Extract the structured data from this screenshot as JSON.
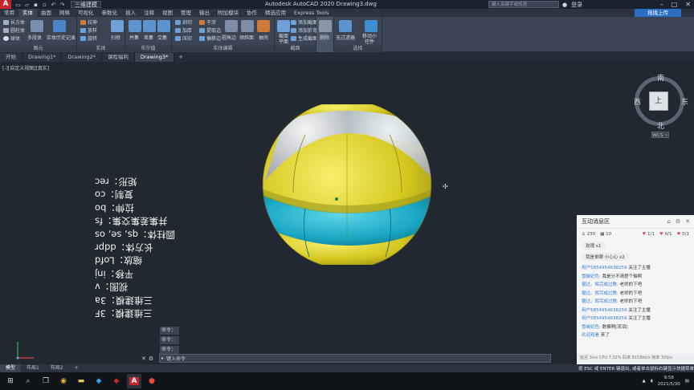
{
  "titlebar": {
    "app_title": "Autodesk AutoCAD 2020    Drawing3.dwg",
    "workspace": "三维建模",
    "search_placeholder": "键入关键字或短语",
    "user": "登录",
    "share_button": "拖拽上传"
  },
  "menu_tabs": [
    "常用",
    "实体",
    "曲面",
    "网格",
    "可视化",
    "参数化",
    "插入",
    "注释",
    "视图",
    "管理",
    "输出",
    "附加模块",
    "协作",
    "精选应用",
    "Express Tools"
  ],
  "active_menu": 1,
  "ribbon": {
    "primitive": {
      "items": [
        "长方体",
        "圆柱体",
        "球体"
      ],
      "big": [
        "多段体",
        "实体历史记录"
      ],
      "title": "图元"
    },
    "solid": {
      "items": [
        "拉伸",
        "放样",
        "旋转",
        "扫掠"
      ],
      "big": [
        "并集",
        "差集",
        "交集"
      ],
      "title": "实体"
    },
    "boolean_title": "布尔值",
    "edit": {
      "items": [
        "剖切",
        "加厚",
        "压印",
        "干涉",
        "提取边",
        "偏移边"
      ],
      "big": [
        "圆角边",
        "倾斜面",
        "抽壳"
      ],
      "title": "实体编辑"
    },
    "section": {
      "items": [
        "添加截面",
        "添加折弯",
        "生成截面"
      ],
      "big": [
        "截面平面"
      ],
      "title": "截面"
    },
    "delete": "删除",
    "selection": {
      "big": [
        "无过滤器",
        "移动小控件"
      ],
      "title": "选择"
    }
  },
  "doc_tabs": [
    "开始",
    "Drawing1*",
    "Drawing2*",
    "课程福利",
    "Drawing3*"
  ],
  "active_doc": 4,
  "viewport": {
    "label": "[-][自定义视图][真实]",
    "compass": {
      "n": "南",
      "s": "北",
      "w": "西",
      "e": "东",
      "face": "上",
      "wcs": "WCS ~"
    }
  },
  "mirrored_text": [
    "三维建模：3F",
    "三维建模：3a",
    "视图：v",
    "平移：inj",
    "缩放：Lofd",
    "长方体：ddpr",
    "圆柱体：qs, se, os",
    "并集差集交集：fs",
    "拉伸：bo",
    "复制：co",
    "矩形：rec"
  ],
  "command": {
    "history": [
      "命令：",
      "命令：",
      "命令："
    ],
    "placeholder": "键入命令"
  },
  "chat": {
    "title": "互动消息区",
    "viewers": "230",
    "likes": "10",
    "counters": [
      "1/1",
      "0/1",
      "0/1"
    ],
    "gifts": [
      "玫瑰 x1",
      "我是单眼 小心心 x2"
    ],
    "messages": [
      {
        "user": "用户5854954638259",
        "text": "关注了主播"
      },
      {
        "user": "雪碳妃色:",
        "text": "我是分不清楚个轴啊"
      },
      {
        "user": "锯过。辉完成过教:",
        "text": "老师的下吧"
      },
      {
        "user": "锯过。辉完成过教:",
        "text": "老师的下吧"
      },
      {
        "user": "锯过。辉完成过教:",
        "text": "老师的下吧"
      },
      {
        "user": "用户5854954638259",
        "text": "关注了主播"
      },
      {
        "user": "用户5854954638259",
        "text": "关注了主播"
      },
      {
        "user": "雪碳妃色:",
        "text": "数模啊[流泪]"
      },
      {
        "user": "欢迎观看",
        "text": "来了"
      }
    ],
    "status": "延迟 3ms  CPU 7.02%  码率 8159kb/s  帧率 30fps"
  },
  "layout_tabs": [
    "模型",
    "布局1",
    "布局2"
  ],
  "hint": "按 ESC 或 ENTER 键退出, 或者单击鼠标右键显示快捷菜单",
  "taskbar": {
    "time": "9:58",
    "date": "2021/5/30"
  }
}
